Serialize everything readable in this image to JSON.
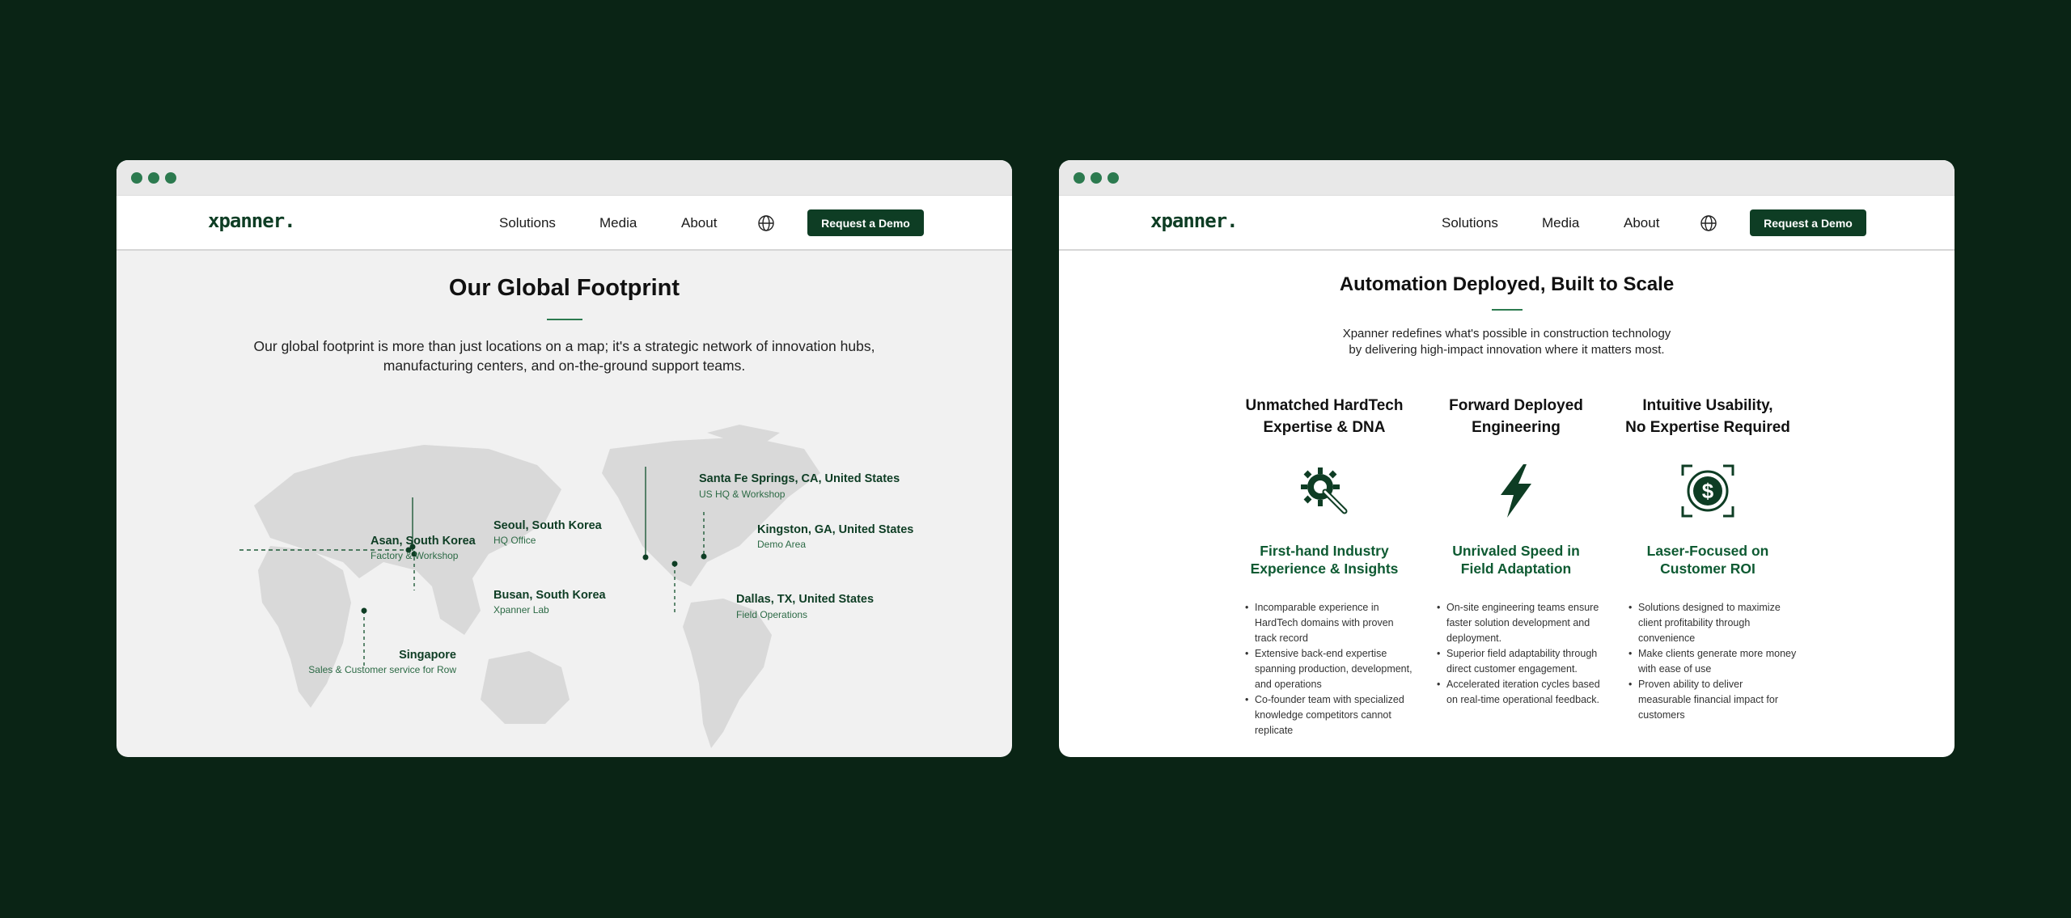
{
  "brand": {
    "logo": "xpanner.",
    "accent": "#0e3d24",
    "highlight": "#2c7a4f",
    "background": "#0a2415"
  },
  "nav": {
    "solutions": "Solutions",
    "media": "Media",
    "about": "About",
    "globe_icon": "globe-icon",
    "demo": "Request a Demo"
  },
  "left_page": {
    "title": "Our Global Footprint",
    "intro_line1": "Our global footprint is more than just locations on a map; it's a strategic network of innovation hubs,",
    "intro_line2": "manufacturing centers, and on-the-ground support teams.",
    "locations": [
      {
        "name": "Asan, South Korea",
        "desc": "Factory & Workshop"
      },
      {
        "name": "Seoul, South Korea",
        "desc": "HQ Office"
      },
      {
        "name": "Busan, South Korea",
        "desc": "Xpanner Lab"
      },
      {
        "name": "Singapore",
        "desc": "Sales & Customer service for Row"
      },
      {
        "name": "Santa Fe Springs, CA, United States",
        "desc": "US HQ & Workshop"
      },
      {
        "name": "Kingston, GA, United States",
        "desc": "Demo Area"
      },
      {
        "name": "Dallas, TX, United States",
        "desc": "Field Operations"
      }
    ]
  },
  "right_page": {
    "title": "Automation Deployed, Built to Scale",
    "intro_line1": "Xpanner redefines what's possible in construction technology",
    "intro_line2": "by delivering high-impact innovation where it matters most.",
    "columns": [
      {
        "heading_line1": "Unmatched HardTech",
        "heading_line2": "Expertise & DNA",
        "icon": "gear-wrench-icon",
        "sub_line1": "First-hand Industry",
        "sub_line2": "Experience & Insights",
        "bullets": [
          "Incomparable experience in HardTech domains with proven track record",
          "Extensive back-end expertise spanning production, development, and operations",
          "Co-founder team with specialized knowledge competitors cannot replicate"
        ]
      },
      {
        "heading_line1": "Forward Deployed",
        "heading_line2": "Engineering",
        "icon": "lightning-bolt-icon",
        "sub_line1": "Unrivaled Speed in",
        "sub_line2": "Field Adaptation",
        "bullets": [
          "On-site engineering teams ensure faster solution development and deployment.",
          "Superior field adaptability through direct customer engagement.",
          "Accelerated iteration cycles based on real-time operational feedback."
        ]
      },
      {
        "heading_line1": "Intuitive Usability,",
        "heading_line2": "No Expertise Required",
        "icon": "dollar-target-icon",
        "sub_line1": "Laser-Focused on",
        "sub_line2": "Customer ROI",
        "bullets": [
          "Solutions designed to maximize client profitability through convenience",
          "Make clients generate more money with ease of use",
          "Proven ability to deliver measurable financial impact for customers"
        ]
      }
    ]
  }
}
